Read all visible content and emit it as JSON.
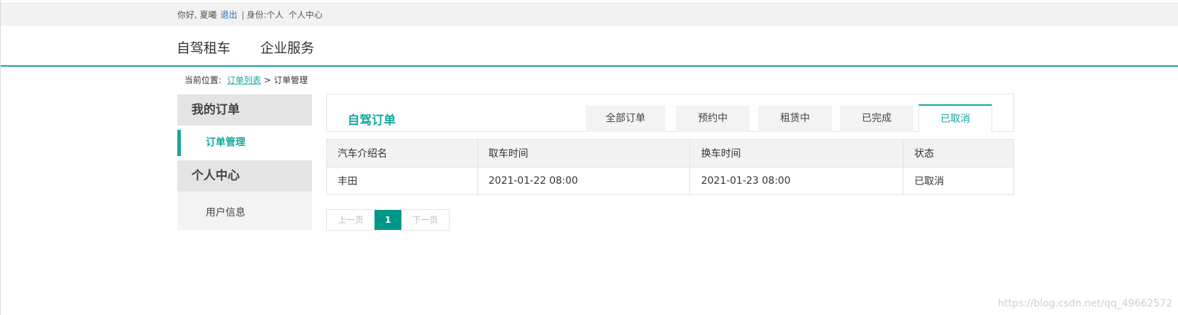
{
  "topbar": {
    "greeting": "你好, 夏曦",
    "logout": "退出",
    "separator": "|",
    "role": "身份:个人",
    "user_center": "个人中心"
  },
  "nav": {
    "items": [
      "自驾租车",
      "企业服务"
    ]
  },
  "breadcrumb": {
    "prefix": "当前位置:",
    "link": "订单列表",
    "separator": ">",
    "current": "订单管理"
  },
  "sidebar": {
    "sections": [
      {
        "title": "我的订单",
        "items": [
          "订单管理"
        ]
      },
      {
        "title": "个人中心",
        "items": [
          "用户信息"
        ]
      }
    ]
  },
  "panel": {
    "title": "自驾订单",
    "tabs": [
      "全部订单",
      "预约中",
      "租赁中",
      "已完成",
      "已取消"
    ],
    "active_tab": "已取消"
  },
  "table": {
    "columns": [
      "汽车介绍名",
      "取车时间",
      "换车时间",
      "状态"
    ],
    "rows": [
      [
        "丰田",
        "2021-01-22 08:00",
        "2021-01-23 08:00",
        "已取消"
      ]
    ]
  },
  "pagination": {
    "prev": "上一页",
    "current": "1",
    "next": "下一页"
  },
  "watermark": "https://blog.csdn.net/qq_49662572",
  "colors": {
    "accent": "#17a6a0",
    "pager_active": "#009688"
  }
}
